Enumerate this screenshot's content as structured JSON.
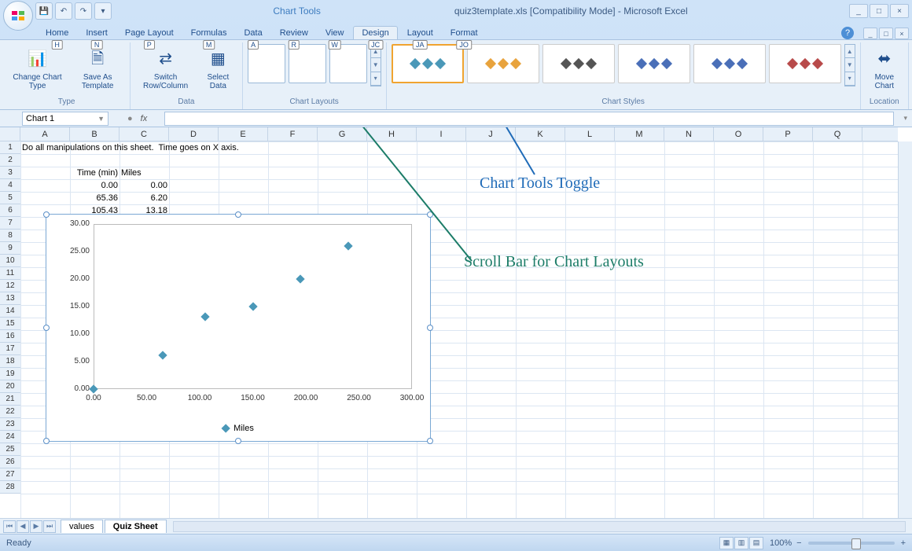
{
  "title": {
    "chart_tools": "Chart Tools",
    "file": "quiz3template.xls  [Compatibility Mode] - Microsoft Excel"
  },
  "tabs": [
    {
      "label": "Home",
      "hint": "H"
    },
    {
      "label": "Insert",
      "hint": "N"
    },
    {
      "label": "Page Layout",
      "hint": "P"
    },
    {
      "label": "Formulas",
      "hint": "M"
    },
    {
      "label": "Data",
      "hint": "A"
    },
    {
      "label": "Review",
      "hint": "R"
    },
    {
      "label": "View",
      "hint": "W"
    },
    {
      "label": "Design",
      "hint": "JC"
    },
    {
      "label": "Layout",
      "hint": "JA"
    },
    {
      "label": "Format",
      "hint": "JO"
    }
  ],
  "ribbon": {
    "type": {
      "changeChart": "Change\nChart Type",
      "saveAs": "Save As\nTemplate",
      "label": "Type"
    },
    "data": {
      "switch": "Switch\nRow/Column",
      "select": "Select\nData",
      "label": "Data"
    },
    "layouts": {
      "label": "Chart Layouts"
    },
    "styles": {
      "label": "Chart Styles"
    },
    "location": {
      "move": "Move\nChart",
      "label": "Location"
    }
  },
  "namebox": "Chart 1",
  "columns": [
    "A",
    "B",
    "C",
    "D",
    "E",
    "F",
    "G",
    "H",
    "I",
    "J",
    "K",
    "L",
    "M",
    "N",
    "O",
    "P",
    "Q"
  ],
  "rowcount": 28,
  "sheet": {
    "a1": "Do all manipulations on this sheet.  Time goes on X axis.",
    "b3": "Time (min)",
    "c3": "Miles",
    "b4": "0.00",
    "c4": "0.00",
    "b5": "65.36",
    "c5": "6.20",
    "b6": "105.43",
    "c6": "13.18"
  },
  "annotations": {
    "toggle": "Chart Tools Toggle",
    "scroll": "Scroll Bar for Chart Layouts"
  },
  "sheet_tabs": {
    "t1": "values",
    "t2": "Quiz Sheet"
  },
  "status": {
    "ready": "Ready",
    "zoom": "100%"
  },
  "chart_data": {
    "type": "scatter",
    "series_name": "Miles",
    "x": [
      0.0,
      65.36,
      105.43,
      150.0,
      195.0,
      240.0
    ],
    "y": [
      0.0,
      6.2,
      13.18,
      15.0,
      20.0,
      26.0
    ],
    "xlim": [
      0,
      300
    ],
    "ylim": [
      0,
      30
    ],
    "xticks": [
      "0.00",
      "50.00",
      "100.00",
      "150.00",
      "200.00",
      "250.00",
      "300.00"
    ],
    "yticks": [
      "0.00",
      "5.00",
      "10.00",
      "15.00",
      "20.00",
      "25.00",
      "30.00"
    ],
    "title": "",
    "xlabel": "",
    "ylabel": "",
    "legend": "Miles"
  }
}
